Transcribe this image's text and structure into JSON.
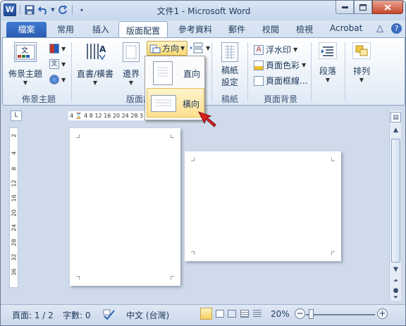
{
  "window": {
    "title": "文件1 - Microsoft Word",
    "qat_logo": "W",
    "controls": {
      "minimize": "▭",
      "maximize": "▭",
      "close": "✕"
    }
  },
  "tabs": {
    "file": "檔案",
    "items": [
      "常用",
      "插入",
      "版面配置",
      "參考資料",
      "郵件",
      "校閱",
      "檢視",
      "Acrobat"
    ],
    "active": "版面配置",
    "right_icons": [
      "△",
      "?"
    ]
  },
  "ribbon": {
    "theme_group": {
      "button": "佈景主題",
      "label": "佈景主題"
    },
    "page_setup": {
      "text_direction": "直書/橫書",
      "margins": "邊界",
      "orientation": "方向",
      "label": "版面設定"
    },
    "manuscript": {
      "button_line1": "稿紙",
      "button_line2": "設定",
      "label": "稿紙"
    },
    "page_background": {
      "watermark": "浮水印",
      "page_color": "頁面色彩",
      "page_borders": "頁面框線...",
      "label": "頁面背景"
    },
    "paragraph": {
      "button": "段落"
    },
    "arrange": {
      "button": "排列"
    }
  },
  "orientation_menu": {
    "items": [
      {
        "label": "直向",
        "icon": "portrait-page-icon",
        "selected": false
      },
      {
        "label": "橫向",
        "icon": "landscape-page-icon",
        "selected": true
      }
    ]
  },
  "ruler": {
    "corner": "L",
    "horizontal_ticks": "4 ⌛ 4 8 12 16 20 24 28 3",
    "vertical_ticks": [
      "2",
      "4",
      "8",
      "12",
      "16",
      "20",
      "24",
      "28",
      "32",
      "36"
    ]
  },
  "status": {
    "page": "頁面: 1 / 2",
    "words": "字數: 0",
    "language": "中文 (台灣)",
    "zoom": "20%",
    "zoom_minus": "−",
    "zoom_plus": "+"
  },
  "colors": {
    "accent": "#2a5cb0",
    "highlight": "#fde08d",
    "workspace": "#cfdbeb"
  }
}
